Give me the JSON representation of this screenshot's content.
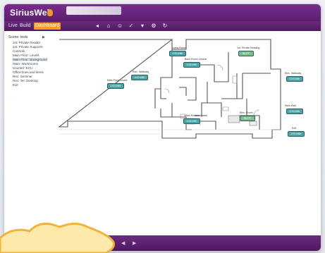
{
  "app": {
    "brand": "SiriusWeb",
    "brand_color": "#6a2a7d",
    "accent_color": "#f39b2b"
  },
  "menu": {
    "items": [
      {
        "label": "Live",
        "active": false
      },
      {
        "label": "Build",
        "active": false
      },
      {
        "label": "Dashboard",
        "active": true
      }
    ]
  },
  "toolbar": {
    "icons": [
      "back-arrow-icon",
      "home-icon",
      "user-icon",
      "check-icon",
      "filter-icon",
      "gear-icon",
      "refresh-icon"
    ]
  },
  "sidebar": {
    "root_label": "Scene: tests",
    "items": [
      "1st: Private Reader",
      "1st: Private Supports",
      "Controls",
      "Main Floor: Levels",
      "Main Floor: Background",
      "Main: Workrooms",
      "Counter: ECU",
      "Office lines and items",
      "Rec: Seminar",
      "Rec: Tel: Desktop",
      "Exit"
    ],
    "selected_index": 4
  },
  "floorplan": {
    "labels": [
      {
        "caption": "Main Floor Levels",
        "value": "0.00 kWh",
        "color": "#4aa6a8"
      },
      {
        "caption": "Elec. Walkway",
        "value": "0.00 kWh",
        "color": "#4aa6a8"
      },
      {
        "caption": "Living Room",
        "value": "0.00 kWh",
        "color": "#4aa6a8"
      },
      {
        "caption": "Back Room Central",
        "value": "0.00 kWh",
        "color": "#4aa6a8"
      },
      {
        "caption": "1st: Private Reading",
        "value": "96.0°F",
        "color": "#7bbf8f"
      },
      {
        "caption": "Elec. Walkway",
        "value": "0.00 kWh",
        "color": "#4aa6a8"
      },
      {
        "caption": "Main Kitchen",
        "value": "0.00 kWh",
        "color": "#4aa6a8"
      },
      {
        "caption": "Elec. Room",
        "value": "96.0°F",
        "color": "#7bbf8f"
      },
      {
        "caption": "Main Wall",
        "value": "0.00 kWh",
        "color": "#4aa6a8"
      },
      {
        "caption": "Exit",
        "value": "0.00 kWh",
        "color": "#4aa6a8"
      }
    ]
  },
  "bottombar": {
    "icons": [
      "left-arrow-icon",
      "right-arrow-icon"
    ]
  }
}
